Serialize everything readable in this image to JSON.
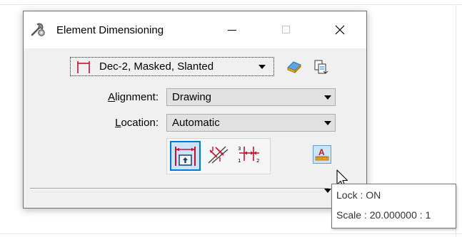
{
  "window": {
    "title": "Element Dimensioning",
    "controls": {
      "minimize": "–",
      "maximize": "☐",
      "close": "×"
    }
  },
  "dimension_style": {
    "value": "Dec-2, Masked, Slanted",
    "icon": "dimension-style-icon"
  },
  "toolbar": {
    "eraser_icon": "eraser-icon",
    "copy_icon": "copy-style-icon"
  },
  "alignment": {
    "label": "Alignment:",
    "label_mnemonic": "A",
    "label_rest": "lignment:",
    "value": "Drawing"
  },
  "location": {
    "label": "Location:",
    "label_mnemonic": "L",
    "label_rest": "ocation:",
    "value": "Automatic"
  },
  "dimension_modes": [
    {
      "icon": "dimension-linear-icon",
      "active": true
    },
    {
      "icon": "dimension-slant-icon",
      "active": false
    },
    {
      "icon": "dimension-chain-icon",
      "active": false
    }
  ],
  "text_button": {
    "icon": "text-style-icon",
    "label": "A"
  },
  "tooltip": {
    "line1": "Lock : ON",
    "line2": "Scale : 20.000000 : 1"
  },
  "colors": {
    "accent": "#0078d7",
    "active_fill": "#cce4f7",
    "dimension_red": "#c8102e",
    "dialog_bg": "#f0f0f0"
  }
}
